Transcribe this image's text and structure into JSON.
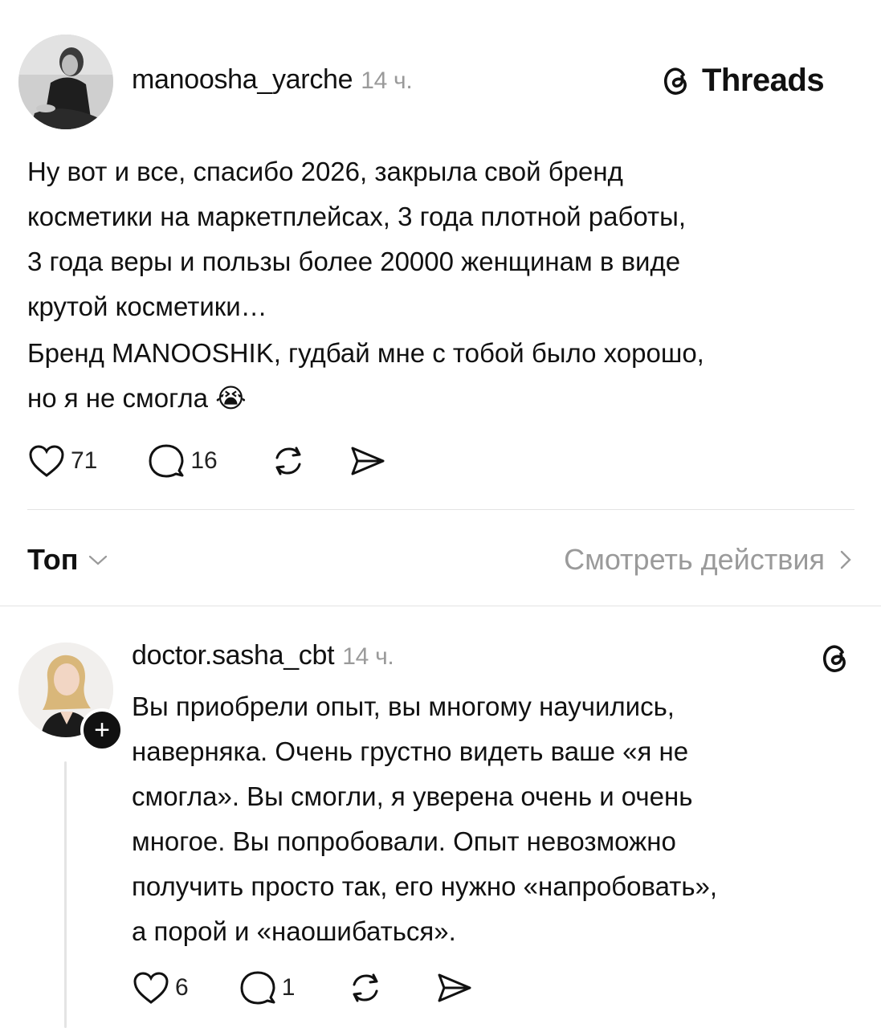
{
  "brand": {
    "name": "Threads",
    "icon": "threads-logo-icon"
  },
  "post": {
    "username": "manoosha_yarche",
    "time": "14 ч.",
    "lines": [
      "Ну вот и все, спасибо 2026, закрыла  свой бренд",
      "косметики на маркетплейсах, 3 года плотной работы,",
      "3 года веры и пользы более 20000 женщинам в виде",
      "крутой косметики…",
      "Бренд MANOOSHIK, гудбай мне с тобой было хорошо,",
      "но я не смогла"
    ],
    "emoji": "😭",
    "likes": "71",
    "comments": "16"
  },
  "sort": {
    "label": "Топ",
    "activity_label": "Смотреть действия"
  },
  "reply": {
    "username": "doctor.sasha_cbt",
    "time": "14 ч.",
    "follow_symbol": "+",
    "lines": [
      "Вы приобрели опыт, вы многому научились,",
      "наверняка. Очень грустно видеть ваше «я не",
      "смогла». Вы смогли, я уверена очень и очень",
      "многое. Вы попробовали. Опыт невозможно",
      "получить просто так, его нужно «напробовать»,",
      "а порой и «наошибаться»."
    ],
    "likes": "6",
    "comments": "1"
  }
}
